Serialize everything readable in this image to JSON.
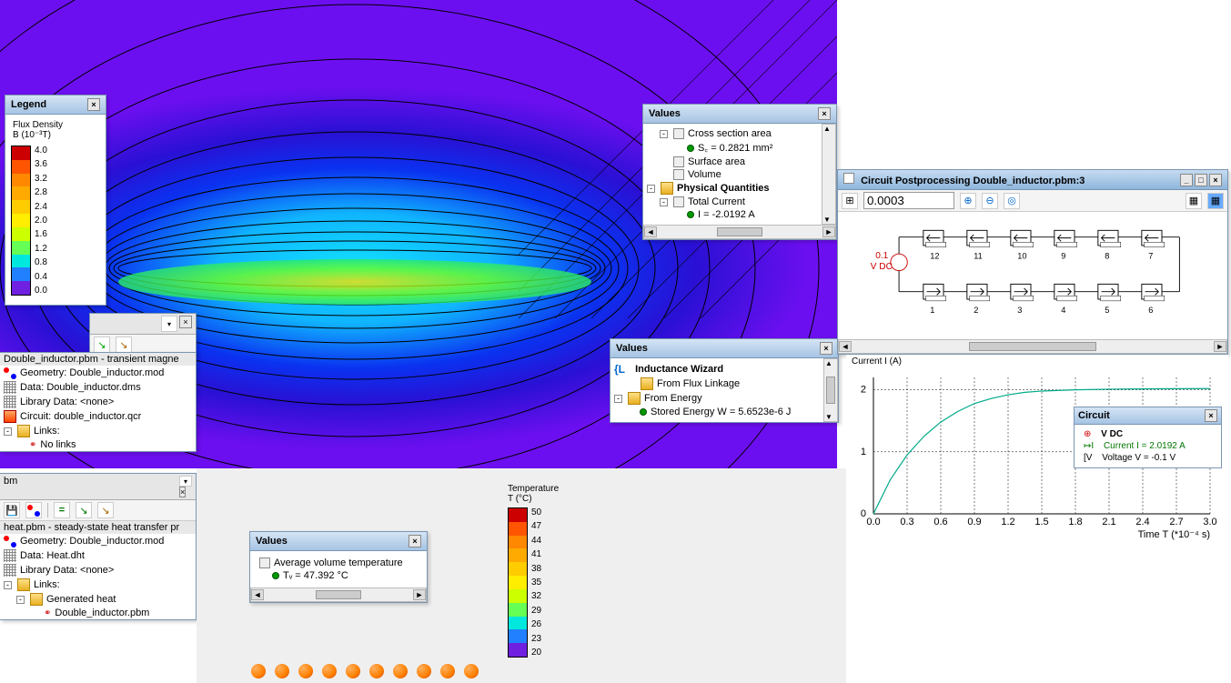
{
  "legend_panel": {
    "title": "Legend",
    "qty_label": "Flux Density",
    "qty_unit": "B (10⁻³T)",
    "ticks": [
      "4.0",
      "3.6",
      "3.2",
      "2.8",
      "2.4",
      "2.0",
      "1.6",
      "1.2",
      "0.8",
      "0.4",
      "0.0"
    ],
    "colors": [
      "#cc0000",
      "#ff5500",
      "#ff8800",
      "#ffaa00",
      "#ffcc00",
      "#ffee00",
      "#ccff00",
      "#66ff55",
      "#00e8dd",
      "#2080ff",
      "#7020e0"
    ]
  },
  "temp_legend": {
    "title": "Temperature",
    "unit": "T (°C)",
    "ticks": [
      "50",
      "47",
      "44",
      "41",
      "38",
      "35",
      "32",
      "29",
      "26",
      "23",
      "20"
    ],
    "colors": [
      "#cc0000",
      "#ff5500",
      "#ff8800",
      "#ffaa00",
      "#ffcc00",
      "#ffee00",
      "#ccff00",
      "#66ff55",
      "#00e8dd",
      "#2080ff",
      "#7020e0"
    ]
  },
  "tree1": {
    "title": "Double_inductor.pbm - transient magne",
    "geometry": "Geometry: Double_inductor.mod",
    "data": "Data: Double_inductor.dms",
    "library": "Library Data: <none>",
    "circuit": "Circuit: double_inductor.qcr",
    "links": "Links:",
    "nolinks": "No links",
    "pane_label": "bm"
  },
  "tree2": {
    "title": "heat.pbm - steady-state heat transfer pr",
    "geometry": "Geometry: Double_inductor.mod",
    "data": "Data: Heat.dht",
    "library": "Library Data: <none>",
    "links": "Links:",
    "generated": "Generated heat",
    "linked_file": "Double_inductor.pbm"
  },
  "values1": {
    "title": "Values",
    "cross": "Cross section area",
    "cross_val": "S꜀ = 0.2821 mm²",
    "surface": "Surface area",
    "volume": "Volume",
    "pq": "Physical Quantities",
    "total_current": "Total Current",
    "total_val": "I = -2.0192 A"
  },
  "values2": {
    "title": "Values",
    "wizard": "Inductance  Wizard",
    "from_flux": "From Flux Linkage",
    "from_energy": "From Energy",
    "stored": "Stored Energy W = 5.6523e-6 J"
  },
  "values3": {
    "title": "Values",
    "avg_temp": "Average volume temperature",
    "avg_val": "Tᵥ = 47.392 °C"
  },
  "circuit_win": {
    "title": "Circuit Postprocessing Double_inductor.pbm:3",
    "time_value": "0.0003",
    "source_label": "0.1",
    "source_unit": "V DC",
    "top_nums": [
      "12",
      "11",
      "10",
      "9",
      "8",
      "7"
    ],
    "bot_nums": [
      "1",
      "2",
      "3",
      "4",
      "5",
      "6"
    ]
  },
  "chart_data": {
    "type": "line",
    "title": "Current I (A)",
    "xlabel": "Time T (*10⁻⁴ s)",
    "ylabel": "",
    "x_ticks": [
      "0.0",
      "0.3",
      "0.6",
      "0.9",
      "1.2",
      "1.5",
      "1.8",
      "2.1",
      "2.4",
      "2.7",
      "3.0"
    ],
    "y_ticks": [
      "0",
      "1",
      "2"
    ],
    "xlim": [
      0,
      3.0
    ],
    "ylim": [
      0,
      2.2
    ],
    "series": [
      {
        "name": "Current",
        "x": [
          0,
          0.15,
          0.3,
          0.45,
          0.6,
          0.75,
          0.9,
          1.05,
          1.2,
          1.35,
          1.5,
          1.8,
          2.1,
          2.4,
          2.7,
          3.0
        ],
        "y": [
          0,
          0.55,
          0.95,
          1.25,
          1.48,
          1.65,
          1.78,
          1.86,
          1.92,
          1.96,
          1.98,
          2.0,
          2.01,
          2.015,
          2.018,
          2.02
        ]
      }
    ]
  },
  "circuit_popup": {
    "title": "Circuit",
    "source": "V DC",
    "current": "Current I = 2.0192 A",
    "voltage": "Voltage V = -0.1 V"
  }
}
